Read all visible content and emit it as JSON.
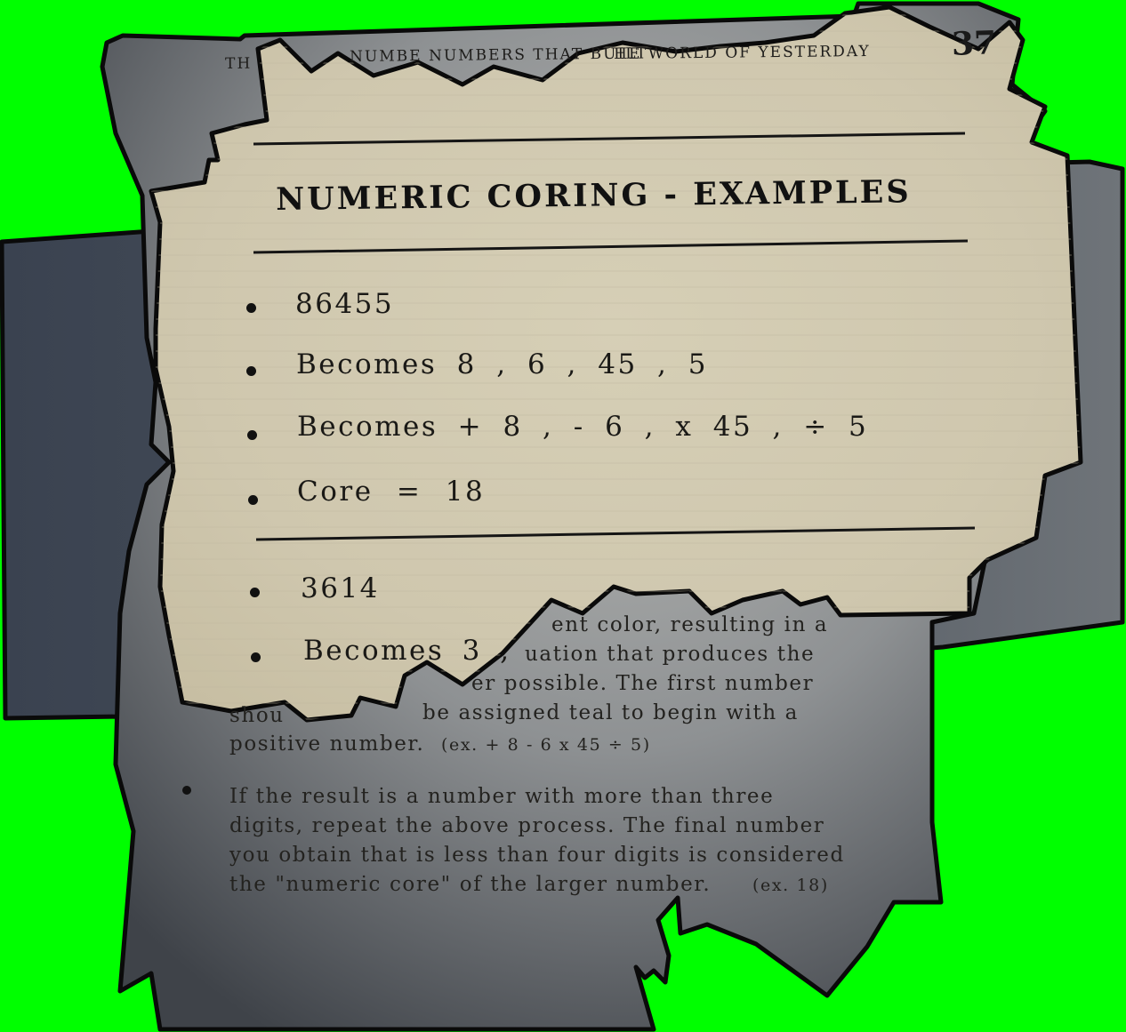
{
  "page": {
    "header": "THE NUMBE NUMBERS THAT BUILT THE WORLD OF YESTERDAY",
    "header_left": "TH",
    "header_mid": "NUMBE NUMBERS THAT BUILT",
    "header_right": "HE WORLD OF YESTERDAY",
    "page_number": "37"
  },
  "card": {
    "title": "NUMERIC CORING - EXAMPLES",
    "example1": {
      "number": "86455",
      "becomes_split": "Becomes 8 , 6 , 45 , 5",
      "becomes_ops": "Becomes + 8 , - 6 , x 45 , ÷ 5",
      "core": "Core = 18"
    },
    "example2": {
      "number": "3614",
      "becomes_partial": "Becomes 3 ,"
    }
  },
  "underlying_page": {
    "para1_line1": "ent color, resulting in a",
    "para1_line2": "uation that produces the",
    "para1_line3": "er possible. The first number",
    "para1_line4a": "shou",
    "para1_line4b": "be assigned teal to begin with a",
    "para1_line5": "positive number.",
    "para1_example": "(ex. + 8 - 6 x 45 ÷ 5)",
    "para2_line1": "If the result is a number with more than three",
    "para2_line2": "digits, repeat the above process. The final number",
    "para2_line3": "you obtain that is less than four digits is considered",
    "para2_line4": "the \"numeric core\" of the larger number.",
    "para2_example": "(ex. 18)"
  },
  "colors": {
    "background": "#00ff00",
    "card_paper": "#d9d2bb",
    "page_paper": "#8b8f92",
    "back_panel": "#39414c",
    "ink": "#1b1a17"
  }
}
